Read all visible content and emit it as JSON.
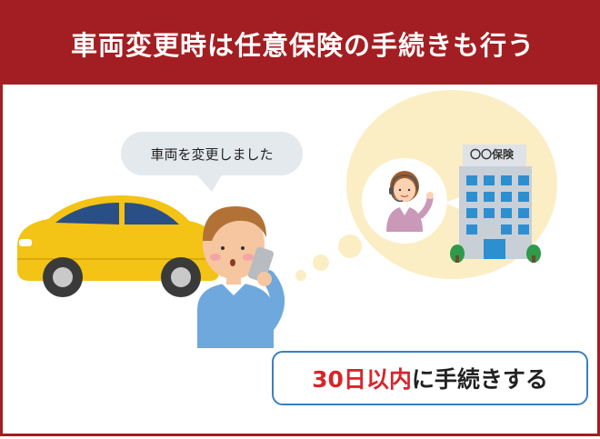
{
  "header": {
    "title": "車両変更時は任意保険の手続きも行う"
  },
  "speech_bubble": {
    "text": "車両を変更しました"
  },
  "office": {
    "sign": "〇〇保険"
  },
  "callout": {
    "highlight": "30日以内",
    "rest": "に手続きする"
  },
  "colors": {
    "header_bg": "#a31e22",
    "callout_highlight": "#d6262c",
    "callout_border": "#3b7fc0",
    "thought_bubble": "#fbeec4",
    "car": "#f3c315"
  },
  "icons": [
    "car-icon",
    "person-on-phone-icon",
    "operator-icon",
    "office-building-icon",
    "thought-bubble-icon"
  ]
}
